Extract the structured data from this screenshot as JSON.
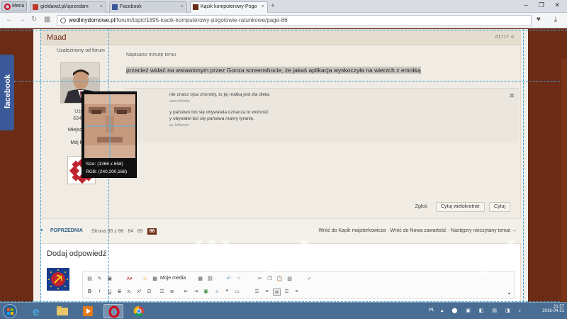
{
  "browser": {
    "menu_label": "Menu",
    "tabs": [
      {
        "label": "gieldawd.pl/sprzedam",
        "active": false
      },
      {
        "label": "Facebook",
        "active": false
      },
      {
        "label": "Kącik komputerowy-Pogo",
        "active": true
      }
    ],
    "url_host": "wedlinydomowe.pl",
    "url_path": "/forum/topic/1895-kacik-komputerowy-pogotowie-ratunkowe/page-86"
  },
  "sidebar_widget": {
    "facebook_label": "facebook"
  },
  "post": {
    "author": "Maad",
    "number": "#1717",
    "author_group": "Uzależniony od forum",
    "author_title": "Użytk",
    "author_posts": "6348 p",
    "author_location": "Miejscowoś",
    "author_my_corner": "Mój kącik",
    "posted": "Napisano minutę temu",
    "message": "przecież widać na wstawionym przez Gonza screenshocie, że jakaś aplikacja wyskoczyła na wierzch z emotką",
    "signature": {
      "line1": "nie znasz ojca choroby, to jej matką jest zła dieta.",
      "line1_src": "owe chińskie",
      "line2": "y państwo boi się obywatela oznacza to wolność.",
      "line3": "y obywatel boi się państwa mamy tyranię.",
      "line3_src": "as Jefferson"
    },
    "report_label": "Zgłoś",
    "multiquote_label": "Cytuj wielokrotnie",
    "quote_label": "Cytuj"
  },
  "magnifier": {
    "size_label": "Size: (1366 x 658)",
    "rgb_label": "RGB: (240,200,168)"
  },
  "pagination": {
    "prev_label": "POPRZEDNIA",
    "page_info": "Strona 86 z 86",
    "pages": [
      "84",
      "85"
    ],
    "current": "86",
    "links": "Wróć do Kącik majsterkowicza · Wróć do Nowa zawartość · Następny nieczytany temat →"
  },
  "reply": {
    "title": "Dodaj odpowiedź",
    "media_label": "Moje media"
  },
  "watermark": "wedlinydomowe.pl",
  "taskbar": {
    "lang": "PL",
    "time": "21:57",
    "date": "2016-04-21"
  },
  "colors": {
    "brand": "#6b2b14",
    "guide": "#3fa3d6",
    "facebook": "#3b5998"
  }
}
